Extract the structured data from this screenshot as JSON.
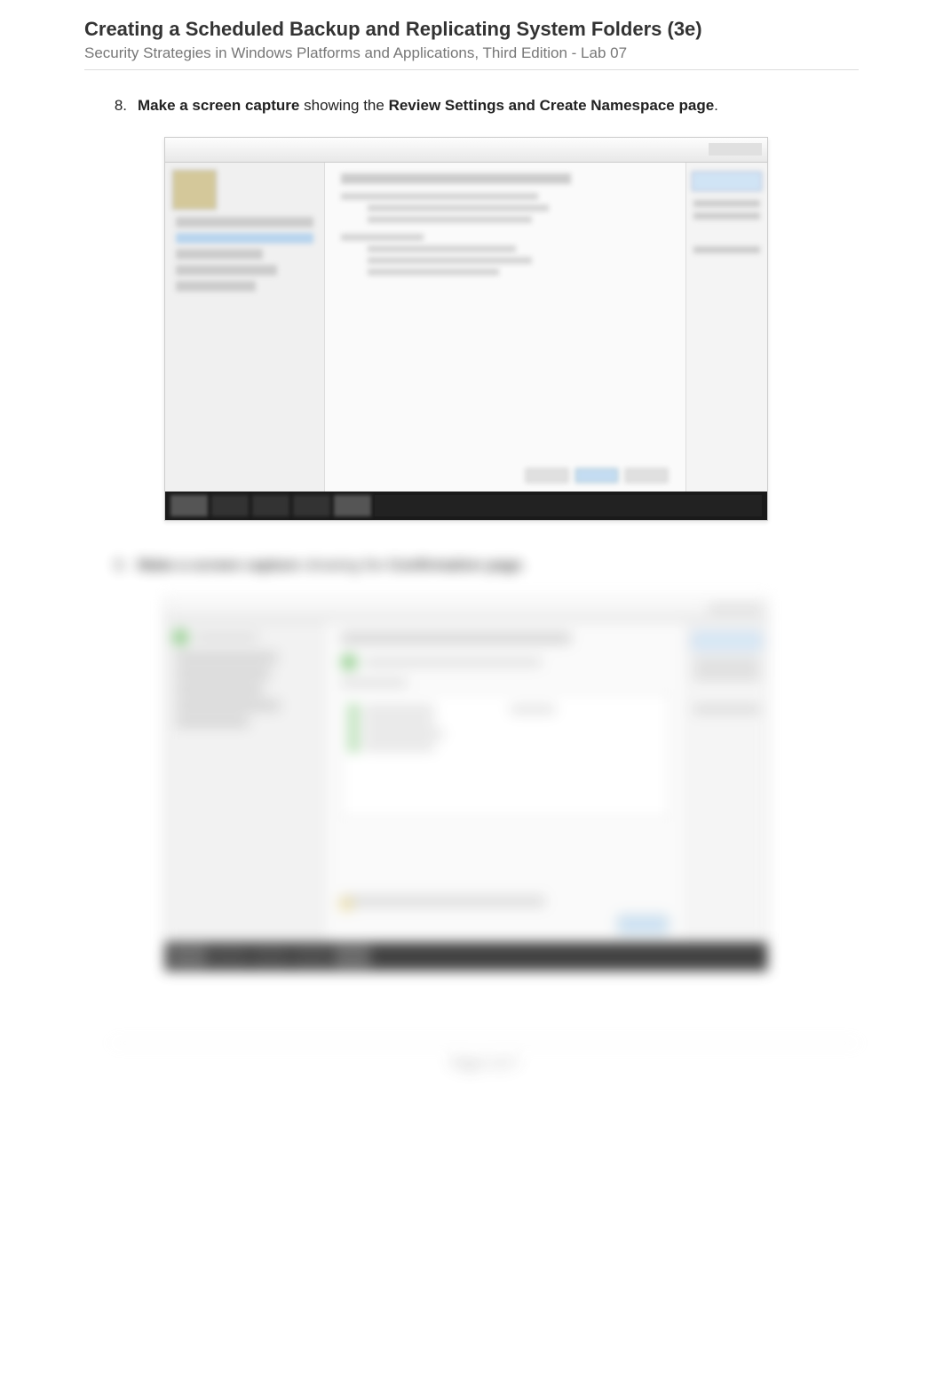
{
  "header": {
    "title": "Creating a Scheduled Backup and Replicating System Folders (3e)",
    "subtitle": "Security Strategies in Windows Platforms and Applications, Third Edition - Lab 07"
  },
  "steps": [
    {
      "number": "8.",
      "bold1": "Make a screen capture",
      "mid": " showing the ",
      "bold2": "Review Settings and Create Namespace page",
      "tail": "."
    },
    {
      "number": "9.",
      "bold1": "Make a screen capture",
      "mid": " showing the ",
      "bold2": "Confirmation page",
      "tail": "."
    }
  ],
  "footer": {
    "text": "Page 4 of 7"
  }
}
